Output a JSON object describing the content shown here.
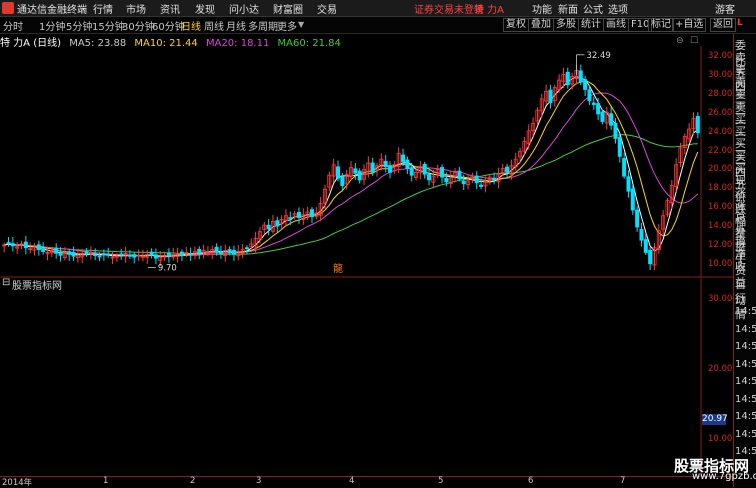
{
  "menubar": {
    "app_name": "通达信金融终端",
    "items": [
      "行情",
      "市场",
      "资讯",
      "发现",
      "问小达",
      "财富圈",
      "交易"
    ],
    "notice": "证券交易未登录",
    "stock": "特 力A",
    "right_items": [
      "功能",
      "新面",
      "公式",
      "选项"
    ],
    "guest": "游客"
  },
  "toolbar": {
    "periods": [
      "分时",
      "1分钟",
      "5分钟",
      "15分钟",
      "30分钟",
      "60分钟",
      "日线",
      "周线",
      "月线",
      "多周期",
      "更多"
    ],
    "active": "日线",
    "right_buttons": [
      "复权",
      "叠加",
      "多股",
      "统计",
      "画线",
      "F10",
      "标记",
      "+自选",
      "返回"
    ]
  },
  "header": {
    "title": "特 力A (日线)",
    "ma5": "MA5: 23.88",
    "ma10": "MA10: 21.44",
    "ma20": "MA20: 18.11",
    "ma60": "MA60: 21.84",
    "colors": {
      "ma5": "#ffffff",
      "ma10": "#ffd800",
      "ma20": "#e040e0",
      "ma60": "#3ccf3c"
    }
  },
  "sub_header": "股票指标网",
  "annotations": {
    "high": "32.49",
    "low": "9.70",
    "mark": "龍"
  },
  "price_axis": [
    "32.00",
    "30.00",
    "28.00",
    "26.00",
    "24.00",
    "22.00",
    "20.00",
    "18.00",
    "16.00",
    "14.00",
    "12.00",
    "10.00"
  ],
  "sub_axis": [
    "30.00",
    "20.00",
    "10.00"
  ],
  "sub_value": "20.97",
  "x_axis": [
    "2014年",
    "1",
    "2",
    "3",
    "4",
    "5",
    "6",
    "7"
  ],
  "right_panel": {
    "top_tag": "L",
    "labels": [
      "委比",
      "卖五",
      "卖四",
      "卖三",
      "卖二",
      "卖一",
      "买一",
      "买二",
      "买三",
      "买四",
      "买五",
      "现价",
      "涨跌",
      "涨幅",
      "总量",
      "外盘",
      "换手",
      "净资",
      "收益"
    ],
    "labels2": [
      "自动",
      "行情"
    ],
    "times": [
      "14:5",
      "14:5",
      "14:5",
      "14:5",
      "14:5",
      "14:5",
      "14:5",
      "14:5",
      "14:5"
    ]
  },
  "watermark": {
    "title": "股票指标网",
    "url": "www.7gpzb.com"
  },
  "chart_data": {
    "type": "candlestick",
    "ylim": [
      8.8,
      33
    ],
    "closes": [
      12.1,
      12.3,
      12.0,
      11.9,
      12.2,
      11.8,
      11.7,
      11.9,
      11.6,
      11.4,
      11.3,
      11.5,
      11.2,
      11.0,
      11.3,
      11.1,
      10.9,
      11.0,
      11.2,
      11.1,
      11.3,
      11.0,
      10.9,
      11.1,
      11.0,
      10.8,
      10.9,
      11.0,
      11.2,
      10.9,
      10.8,
      11.0,
      10.9,
      11.1,
      11.0,
      10.7,
      10.8,
      11.0,
      10.9,
      11.1,
      11.2,
      11.0,
      11.3,
      11.1,
      11.4,
      11.2,
      11.5,
      11.3,
      11.6,
      11.4,
      11.2,
      11.5,
      11.3,
      11.1,
      11.4,
      11.6,
      11.8,
      12.2,
      12.8,
      13.5,
      14.2,
      13.8,
      14.6,
      14.1,
      14.8,
      15.2,
      14.9,
      15.4,
      15.0,
      15.3,
      15.6,
      15.1,
      15.5,
      16.5,
      18.0,
      19.5,
      20.6,
      19.2,
      18.4,
      19.6,
      20.3,
      19.7,
      19.0,
      20.1,
      20.8,
      19.8,
      20.5,
      21.2,
      20.4,
      19.8,
      20.6,
      21.8,
      20.9,
      20.2,
      19.5,
      19.8,
      20.4,
      19.6,
      19.0,
      19.4,
      20.1,
      19.3,
      18.8,
      19.2,
      19.8,
      19.1,
      18.6,
      18.9,
      19.4,
      18.7,
      18.3,
      18.8,
      19.3,
      19.0,
      19.6,
      20.2,
      19.8,
      20.5,
      21.2,
      22.0,
      23.1,
      24.2,
      25.0,
      26.4,
      27.6,
      28.4,
      27.2,
      28.8,
      29.6,
      30.2,
      29.1,
      30.0,
      30.6,
      29.4,
      28.6,
      27.4,
      27.0,
      26.0,
      25.2,
      26.2,
      24.8,
      23.4,
      21.5,
      19.4,
      17.8,
      15.8,
      14.0,
      12.6,
      11.3,
      10.1,
      11.8,
      13.6,
      15.2,
      16.8,
      18.4,
      20.6,
      22.4,
      23.6,
      24.4,
      25.5,
      24.0
    ]
  }
}
